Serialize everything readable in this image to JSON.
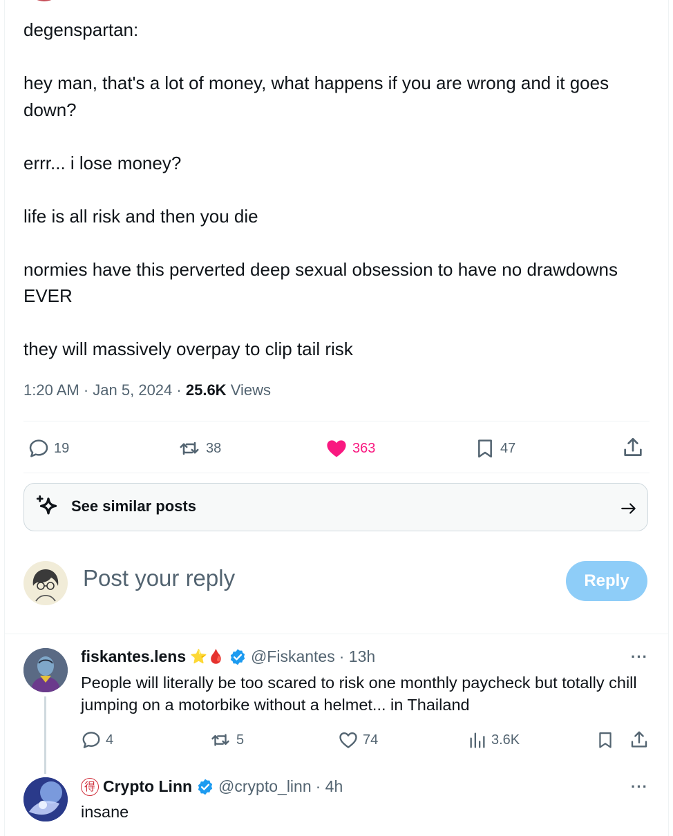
{
  "post": {
    "text": "degenspartan:\n\nhey man, that's a lot of money, what happens if you are wrong and it goes down?\n\nerrr... i lose money?\n\nlife is all risk and then you die\n\nnormies have this perverted deep sexual obsession to have no drawdowns EVER\n\nthey will massively overpay to clip tail risk",
    "time": "1:20 AM",
    "date": "Jan 5, 2024",
    "views_count": "25.6K",
    "views_label": "Views",
    "separator": "·",
    "stats": {
      "replies": "19",
      "reposts": "38",
      "likes": "363",
      "bookmarks": "47"
    }
  },
  "similar": {
    "label": "See similar posts"
  },
  "composer": {
    "placeholder": "Post your reply",
    "button": "Reply"
  },
  "replies": [
    {
      "name": "fiskantes.lens",
      "emoji": "⭐🩸",
      "handle": "@Fiskantes",
      "time": "· 13h",
      "text": "People will literally be too scared to risk one monthly paycheck but totally chill jumping on a motorbike without a helmet... in Thailand",
      "stats": {
        "replies": "4",
        "reposts": "5",
        "likes": "74",
        "views": "3.6K"
      }
    },
    {
      "badge": "得",
      "name": "Crypto Linn",
      "handle": "@crypto_linn",
      "time": "· 4h",
      "text": "insane"
    }
  ],
  "colors": {
    "like": "#f91880",
    "verified": "#1d9bf0",
    "reply_button": "#8ecdf8",
    "secondary": "#536471"
  },
  "icons": [
    "reply-icon",
    "repost-icon",
    "heart-icon",
    "bookmark-icon",
    "share-icon",
    "sparkle-icon",
    "arrow-right-icon",
    "views-icon",
    "more-icon",
    "verified-icon"
  ]
}
